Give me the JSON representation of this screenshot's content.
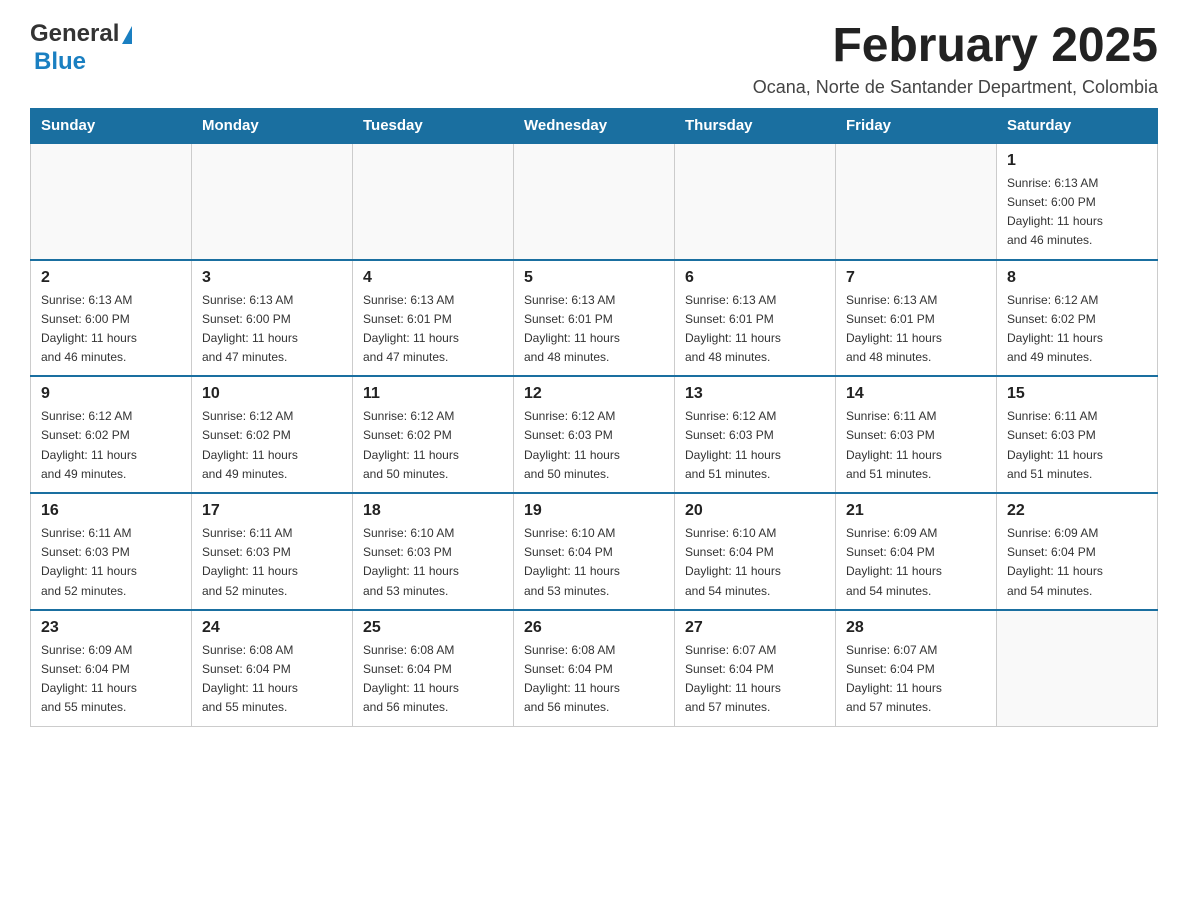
{
  "header": {
    "logo": {
      "general": "General",
      "blue": "Blue"
    },
    "title": "February 2025",
    "subtitle": "Ocana, Norte de Santander Department, Colombia"
  },
  "calendar": {
    "days_of_week": [
      "Sunday",
      "Monday",
      "Tuesday",
      "Wednesday",
      "Thursday",
      "Friday",
      "Saturday"
    ],
    "weeks": [
      [
        {
          "day": "",
          "info": ""
        },
        {
          "day": "",
          "info": ""
        },
        {
          "day": "",
          "info": ""
        },
        {
          "day": "",
          "info": ""
        },
        {
          "day": "",
          "info": ""
        },
        {
          "day": "",
          "info": ""
        },
        {
          "day": "1",
          "info": "Sunrise: 6:13 AM\nSunset: 6:00 PM\nDaylight: 11 hours\nand 46 minutes."
        }
      ],
      [
        {
          "day": "2",
          "info": "Sunrise: 6:13 AM\nSunset: 6:00 PM\nDaylight: 11 hours\nand 46 minutes."
        },
        {
          "day": "3",
          "info": "Sunrise: 6:13 AM\nSunset: 6:00 PM\nDaylight: 11 hours\nand 47 minutes."
        },
        {
          "day": "4",
          "info": "Sunrise: 6:13 AM\nSunset: 6:01 PM\nDaylight: 11 hours\nand 47 minutes."
        },
        {
          "day": "5",
          "info": "Sunrise: 6:13 AM\nSunset: 6:01 PM\nDaylight: 11 hours\nand 48 minutes."
        },
        {
          "day": "6",
          "info": "Sunrise: 6:13 AM\nSunset: 6:01 PM\nDaylight: 11 hours\nand 48 minutes."
        },
        {
          "day": "7",
          "info": "Sunrise: 6:13 AM\nSunset: 6:01 PM\nDaylight: 11 hours\nand 48 minutes."
        },
        {
          "day": "8",
          "info": "Sunrise: 6:12 AM\nSunset: 6:02 PM\nDaylight: 11 hours\nand 49 minutes."
        }
      ],
      [
        {
          "day": "9",
          "info": "Sunrise: 6:12 AM\nSunset: 6:02 PM\nDaylight: 11 hours\nand 49 minutes."
        },
        {
          "day": "10",
          "info": "Sunrise: 6:12 AM\nSunset: 6:02 PM\nDaylight: 11 hours\nand 49 minutes."
        },
        {
          "day": "11",
          "info": "Sunrise: 6:12 AM\nSunset: 6:02 PM\nDaylight: 11 hours\nand 50 minutes."
        },
        {
          "day": "12",
          "info": "Sunrise: 6:12 AM\nSunset: 6:03 PM\nDaylight: 11 hours\nand 50 minutes."
        },
        {
          "day": "13",
          "info": "Sunrise: 6:12 AM\nSunset: 6:03 PM\nDaylight: 11 hours\nand 51 minutes."
        },
        {
          "day": "14",
          "info": "Sunrise: 6:11 AM\nSunset: 6:03 PM\nDaylight: 11 hours\nand 51 minutes."
        },
        {
          "day": "15",
          "info": "Sunrise: 6:11 AM\nSunset: 6:03 PM\nDaylight: 11 hours\nand 51 minutes."
        }
      ],
      [
        {
          "day": "16",
          "info": "Sunrise: 6:11 AM\nSunset: 6:03 PM\nDaylight: 11 hours\nand 52 minutes."
        },
        {
          "day": "17",
          "info": "Sunrise: 6:11 AM\nSunset: 6:03 PM\nDaylight: 11 hours\nand 52 minutes."
        },
        {
          "day": "18",
          "info": "Sunrise: 6:10 AM\nSunset: 6:03 PM\nDaylight: 11 hours\nand 53 minutes."
        },
        {
          "day": "19",
          "info": "Sunrise: 6:10 AM\nSunset: 6:04 PM\nDaylight: 11 hours\nand 53 minutes."
        },
        {
          "day": "20",
          "info": "Sunrise: 6:10 AM\nSunset: 6:04 PM\nDaylight: 11 hours\nand 54 minutes."
        },
        {
          "day": "21",
          "info": "Sunrise: 6:09 AM\nSunset: 6:04 PM\nDaylight: 11 hours\nand 54 minutes."
        },
        {
          "day": "22",
          "info": "Sunrise: 6:09 AM\nSunset: 6:04 PM\nDaylight: 11 hours\nand 54 minutes."
        }
      ],
      [
        {
          "day": "23",
          "info": "Sunrise: 6:09 AM\nSunset: 6:04 PM\nDaylight: 11 hours\nand 55 minutes."
        },
        {
          "day": "24",
          "info": "Sunrise: 6:08 AM\nSunset: 6:04 PM\nDaylight: 11 hours\nand 55 minutes."
        },
        {
          "day": "25",
          "info": "Sunrise: 6:08 AM\nSunset: 6:04 PM\nDaylight: 11 hours\nand 56 minutes."
        },
        {
          "day": "26",
          "info": "Sunrise: 6:08 AM\nSunset: 6:04 PM\nDaylight: 11 hours\nand 56 minutes."
        },
        {
          "day": "27",
          "info": "Sunrise: 6:07 AM\nSunset: 6:04 PM\nDaylight: 11 hours\nand 57 minutes."
        },
        {
          "day": "28",
          "info": "Sunrise: 6:07 AM\nSunset: 6:04 PM\nDaylight: 11 hours\nand 57 minutes."
        },
        {
          "day": "",
          "info": ""
        }
      ]
    ]
  }
}
